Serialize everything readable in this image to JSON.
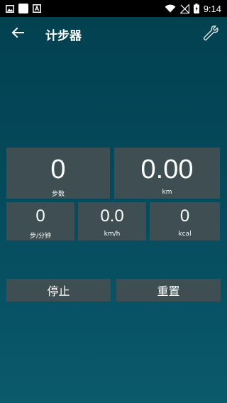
{
  "status_bar": {
    "time": "9:14"
  },
  "app_bar": {
    "title": "计步器",
    "back_icon": "arrow-left-icon",
    "settings_icon": "wrench-icon"
  },
  "stats": {
    "steps": {
      "value": "0",
      "label": "步数"
    },
    "distance": {
      "value": "0.00",
      "label": "km"
    },
    "cadence": {
      "value": "0",
      "label": "步/分钟"
    },
    "speed": {
      "value": "0.0",
      "label": "km/h"
    },
    "calories": {
      "value": "0",
      "label": "kcal"
    }
  },
  "buttons": {
    "stop_label": "停止",
    "reset_label": "重置"
  },
  "colors": {
    "background_top": "#02404f",
    "background_bottom": "#0a5a6c",
    "tile": "#3f4e52"
  }
}
